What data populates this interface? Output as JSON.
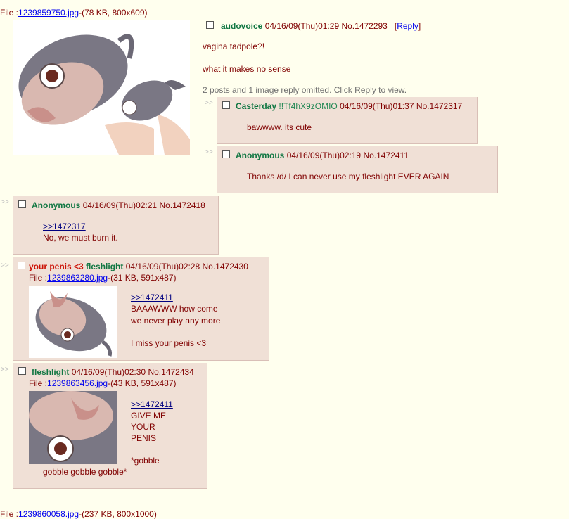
{
  "op": {
    "file_label": "File :",
    "file_name": "1239859750.jpg",
    "file_meta": "-(78 KB, 800x609)",
    "name": "audovoice",
    "date": "04/16/09(Thu)01:29",
    "number": "No.1472293",
    "reply_link": "Reply",
    "comment_lines": [
      "vagina tadpole?!",
      "what it makes no sense"
    ],
    "omitted": "2 posts and 1 image reply omitted. Click Reply to view."
  },
  "replies": [
    {
      "arrows": ">>",
      "name": "Casterday",
      "trip": "!!Tf4hX9zOMIO",
      "date": "04/16/09(Thu)01:37",
      "number": "No.1472317",
      "comment": "bawwww. its cute"
    },
    {
      "arrows": ">>",
      "name": "Anonymous",
      "date": "04/16/09(Thu)02:19",
      "number": "No.1472411",
      "comment": "Thanks /d/ I can never use my fleshlight EVER AGAIN"
    },
    {
      "arrows": ">>",
      "name": "Anonymous",
      "date": "04/16/09(Thu)02:21",
      "number": "No.1472418",
      "quote": ">>1472317",
      "comment": "No, we must burn it."
    },
    {
      "arrows": ">>",
      "subject": "your penis <3",
      "name": "fleshlight",
      "date": "04/16/09(Thu)02:28",
      "number": "No.1472430",
      "file_label": "File :",
      "file_name": "1239863280.jpg",
      "file_meta": "-(31 KB, 591x487)",
      "quote": ">>1472411",
      "lines": [
        "BAAAWWW how come",
        "we never play any more",
        "I miss your penis <3"
      ]
    },
    {
      "arrows": ">>",
      "name": "fleshlight",
      "date": "04/16/09(Thu)02:30",
      "number": "No.1472434",
      "file_label": "File :",
      "file_name": "1239863456.jpg",
      "file_meta": "-(43 KB, 591x487)",
      "quote": ">>1472411",
      "lines": [
        "GIVE ME",
        "YOUR",
        "PENIS",
        "*gobble",
        "gobble gobble gobble*"
      ]
    }
  ],
  "next": {
    "file_label": "File :",
    "file_name": "1239860058.jpg",
    "file_meta": "-(237 KB, 800x1000)"
  }
}
